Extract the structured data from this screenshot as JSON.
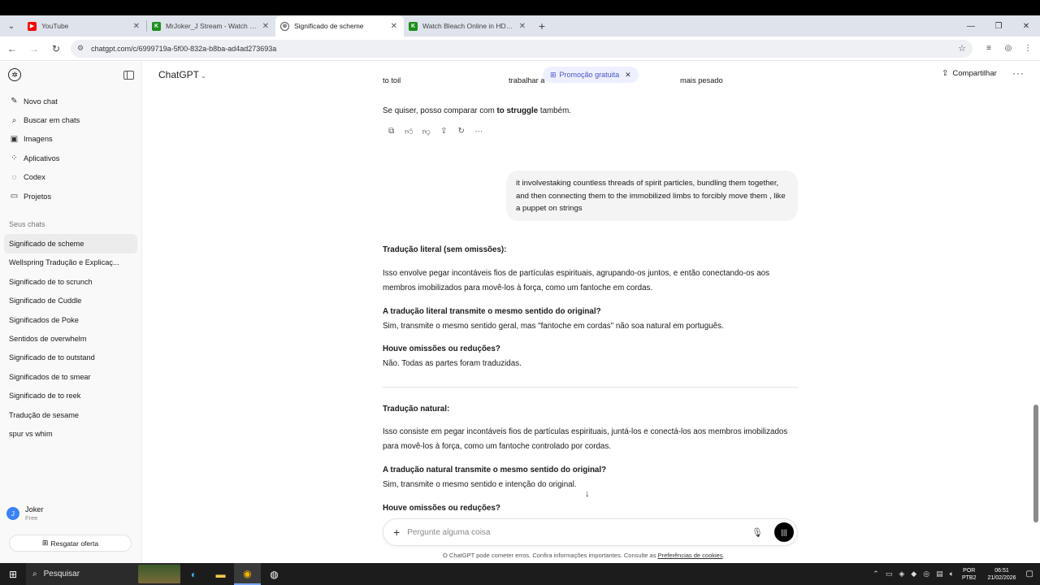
{
  "browser": {
    "tabs": [
      {
        "title": "YouTube",
        "favicon_color": "#ff0000",
        "favicon_glyph": "▶",
        "active": false
      },
      {
        "title": "MrJoker_J Stream - Watch Live",
        "favicon_color": "#1a8f1a",
        "favicon_glyph": "K",
        "active": false
      },
      {
        "title": "Significado de scheme",
        "favicon_color": "#444444",
        "favicon_glyph": "⊛",
        "active": true
      },
      {
        "title": "Watch Bleach Online in HD - An",
        "favicon_color": "#1a8f1a",
        "favicon_glyph": "K",
        "active": false
      }
    ],
    "url": "chatgpt.com/c/6999719a-5f00-832a-b8ba-ad4ad273693a"
  },
  "sidebar": {
    "nav": [
      {
        "label": "Novo chat",
        "icon": "pencil-icon"
      },
      {
        "label": "Buscar em chats",
        "icon": "search-icon"
      },
      {
        "label": "Imagens",
        "icon": "image-icon"
      },
      {
        "label": "Aplicativos",
        "icon": "apps-icon"
      },
      {
        "label": "Codex",
        "icon": "codex-icon"
      },
      {
        "label": "Projetos",
        "icon": "folder-icon"
      }
    ],
    "section_label": "Seus chats",
    "chats": [
      "Significado de scheme",
      "Wellspring Tradução e Explicaç...",
      "Significado de to scrunch",
      "Significado de Cuddle",
      "Significados de Poke",
      "Sentidos de overwhelm",
      "Significado de to outstand",
      "Significados de to smear",
      "Significado de to reek",
      "Tradução de sesame",
      "spur vs whim"
    ],
    "user": {
      "initial": "J",
      "name": "Joker",
      "plan": "Free"
    },
    "offer_label": "Resgatar oferta"
  },
  "header": {
    "model": "ChatGPT",
    "promo": "Promoção gratuita",
    "share": "Compartilhar"
  },
  "conversation": {
    "table_row": [
      "to toil",
      "trabalhar a",
      "mais pesado"
    ],
    "offer_prefix": "Se quiser, posso comparar com ",
    "offer_bold": "to struggle",
    "offer_suffix": " também.",
    "user_message": "it involvestaking countless threads of spirit particles, bundling them together, and then connecting them to the immobilized limbs to forcibly move them , like a  puppet on strings",
    "literal_heading": "Tradução literal (sem omissões):",
    "literal_text": "Isso envolve pegar incontáveis fios de partículas espirituais, agrupando-os juntos, e então conectando-os aos membros imobilizados para movê-los à força, como um fantoche em cordas.",
    "literal_q1": "A tradução literal transmite o mesmo sentido do original?",
    "literal_a1": "Sim, transmite o mesmo sentido geral, mas \"fantoche em cordas\" não soa natural em português.",
    "literal_q2": "Houve omissões ou reduções?",
    "literal_a2": "Não. Todas as partes foram traduzidas.",
    "natural_heading": "Tradução natural:",
    "natural_text": "Isso consiste em pegar incontáveis fios de partículas espirituais, juntá-los e conectá-los aos membros imobilizados para movê-los à força, como um fantoche controlado por cordas.",
    "natural_q1": "A tradução natural transmite o mesmo sentido do original?",
    "natural_a1": "Sim, transmite o mesmo sentido e intenção do original.",
    "natural_q2": "Houve omissões ou reduções?"
  },
  "composer": {
    "placeholder": "Pergunte alguma coisa"
  },
  "disclaimer": {
    "text": "O ChatGPT pode cometer erros. Confira informações importantes. Consulte as ",
    "link": "Preferências de cookies",
    "end": "."
  },
  "taskbar": {
    "search": "Pesquisar",
    "lang_top": "POR",
    "lang_bottom": "PTB2",
    "time": "06:51",
    "date": "21/02/2026"
  }
}
